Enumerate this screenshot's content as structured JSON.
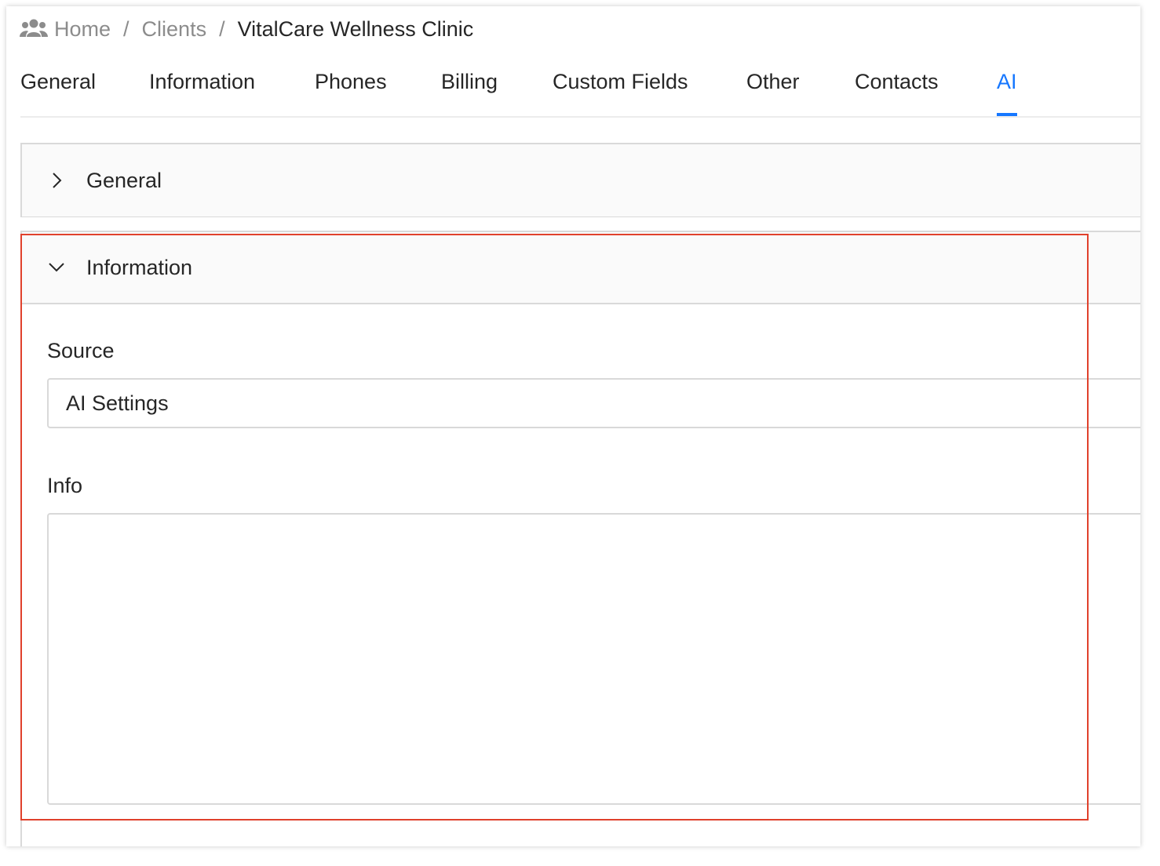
{
  "breadcrumb": {
    "icon": "users-icon",
    "items": [
      "Home",
      "Clients",
      "VitalCare Wellness Clinic"
    ],
    "separator": "/"
  },
  "tabs": [
    {
      "label": "General",
      "active": false
    },
    {
      "label": "Information",
      "active": false
    },
    {
      "label": "Phones",
      "active": false
    },
    {
      "label": "Billing",
      "active": false
    },
    {
      "label": "Custom Fields",
      "active": false
    },
    {
      "label": "Other",
      "active": false
    },
    {
      "label": "Contacts",
      "active": false
    },
    {
      "label": "AI",
      "active": true
    }
  ],
  "panels": {
    "general": {
      "title": "General",
      "expanded": false,
      "icon": "chevron-right-icon"
    },
    "information": {
      "title": "Information",
      "expanded": true,
      "icon": "chevron-down-icon"
    }
  },
  "form": {
    "source_label": "Source",
    "source_value": "AI Settings",
    "info_label": "Info",
    "info_value": ""
  },
  "colors": {
    "accent": "#1677ff",
    "highlight": "#e0412c",
    "muted": "#8c8c8c",
    "border": "#d9d9d9"
  }
}
